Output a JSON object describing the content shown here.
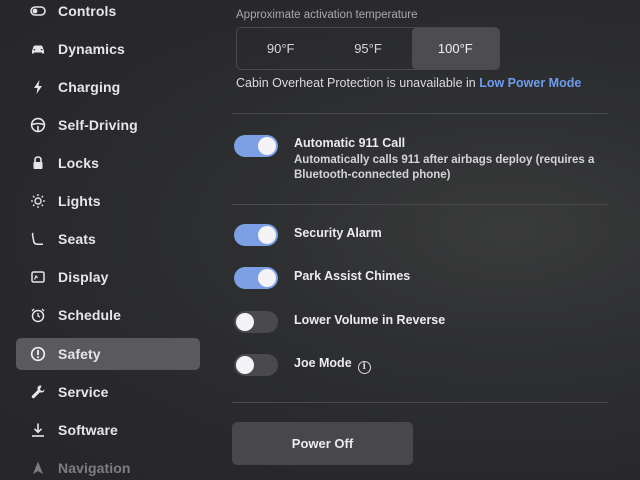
{
  "sidebar": {
    "items": [
      {
        "label": "Controls",
        "icon": "toggle-icon"
      },
      {
        "label": "Dynamics",
        "icon": "car-icon"
      },
      {
        "label": "Charging",
        "icon": "lightning-icon"
      },
      {
        "label": "Self-Driving",
        "icon": "steering-wheel-icon"
      },
      {
        "label": "Locks",
        "icon": "lock-icon"
      },
      {
        "label": "Lights",
        "icon": "sun-icon"
      },
      {
        "label": "Seats",
        "icon": "seat-icon"
      },
      {
        "label": "Display",
        "icon": "display-icon"
      },
      {
        "label": "Schedule",
        "icon": "alarm-clock-icon"
      },
      {
        "label": "Safety",
        "icon": "alert-circle-icon",
        "active": true
      },
      {
        "label": "Service",
        "icon": "wrench-icon"
      },
      {
        "label": "Software",
        "icon": "download-icon"
      },
      {
        "label": "Navigation",
        "icon": "navigation-arrow-icon"
      }
    ]
  },
  "cabin_overheat": {
    "caption": "Approximate activation temperature",
    "options": [
      "90°F",
      "95°F",
      "100°F"
    ],
    "selected": "100°F",
    "unavailable_text": "Cabin Overheat Protection is unavailable in",
    "unavailable_link": "Low Power Mode"
  },
  "settings": {
    "auto_911": {
      "title": "Automatic 911 Call",
      "description": "Automatically calls 911 after airbags deploy (requires a Bluetooth-connected phone)",
      "enabled": true
    },
    "security_alarm": {
      "title": "Security Alarm",
      "enabled": true
    },
    "park_assist": {
      "title": "Park Assist Chimes",
      "enabled": true
    },
    "lower_volume": {
      "title": "Lower Volume in Reverse",
      "enabled": false
    },
    "joe_mode": {
      "title": "Joe Mode",
      "enabled": false,
      "info_glyph": "i"
    }
  },
  "power_off": {
    "label": "Power Off"
  },
  "colors": {
    "accent": "#7d9fe6",
    "link": "#6f9cf0",
    "selected_nav": "#5a5a5d"
  }
}
